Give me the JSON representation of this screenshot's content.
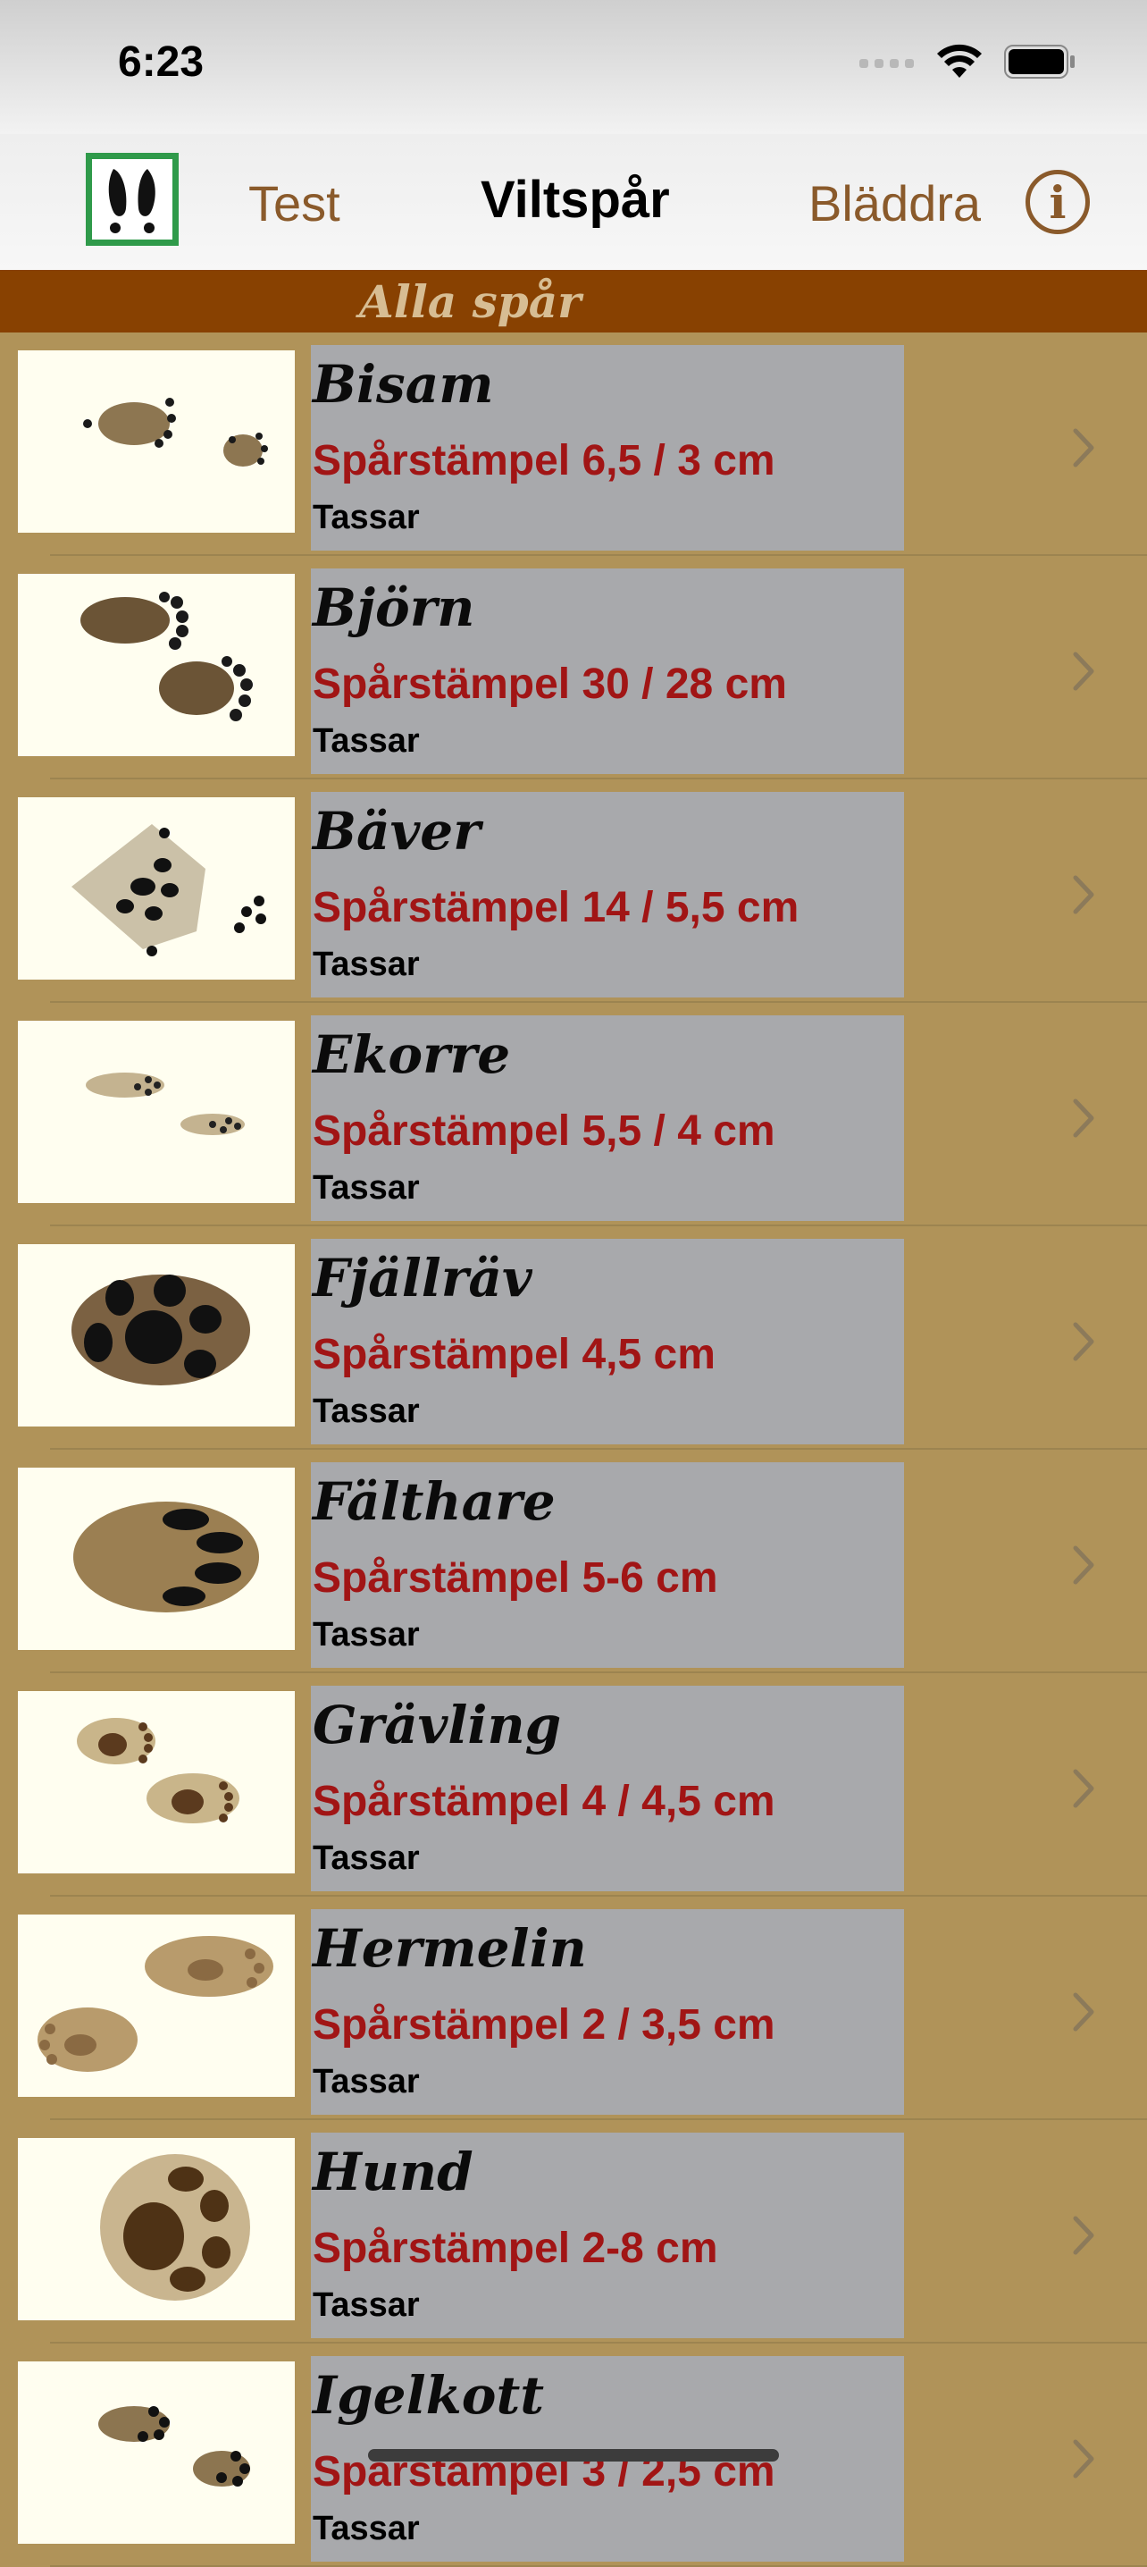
{
  "status": {
    "time": "6:23"
  },
  "nav": {
    "test_label": "Test",
    "title": "Viltspår",
    "browse_label": "Bläddra"
  },
  "section": {
    "title": "Alla spår"
  },
  "animals": [
    {
      "name": "Bisam",
      "size": "Spårstämpel 6,5 / 3 cm",
      "sub": "Tassar"
    },
    {
      "name": "Björn",
      "size": "Spårstämpel 30 / 28 cm",
      "sub": "Tassar"
    },
    {
      "name": "Bäver",
      "size": "Spårstämpel 14 / 5,5 cm",
      "sub": "Tassar"
    },
    {
      "name": "Ekorre",
      "size": "Spårstämpel 5,5 / 4 cm",
      "sub": "Tassar"
    },
    {
      "name": "Fjällräv",
      "size": "Spårstämpel 4,5 cm",
      "sub": "Tassar"
    },
    {
      "name": "Fälthare",
      "size": "Spårstämpel 5-6 cm",
      "sub": "Tassar"
    },
    {
      "name": "Grävling",
      "size": "Spårstämpel 4 / 4,5 cm",
      "sub": "Tassar"
    },
    {
      "name": "Hermelin",
      "size": "Spårstämpel 2 / 3,5 cm",
      "sub": "Tassar"
    },
    {
      "name": "Hund",
      "size": "Spårstämpel 2-8 cm",
      "sub": "Tassar"
    },
    {
      "name": "Igelkott",
      "size": "Spårstämpel 3 / 2,5 cm",
      "sub": "Tassar"
    }
  ],
  "colors": {
    "background": "#b09359",
    "section": "#884101",
    "card": "#a8a9ac",
    "size_text": "#a11515",
    "accent": "#8a5a2b"
  }
}
